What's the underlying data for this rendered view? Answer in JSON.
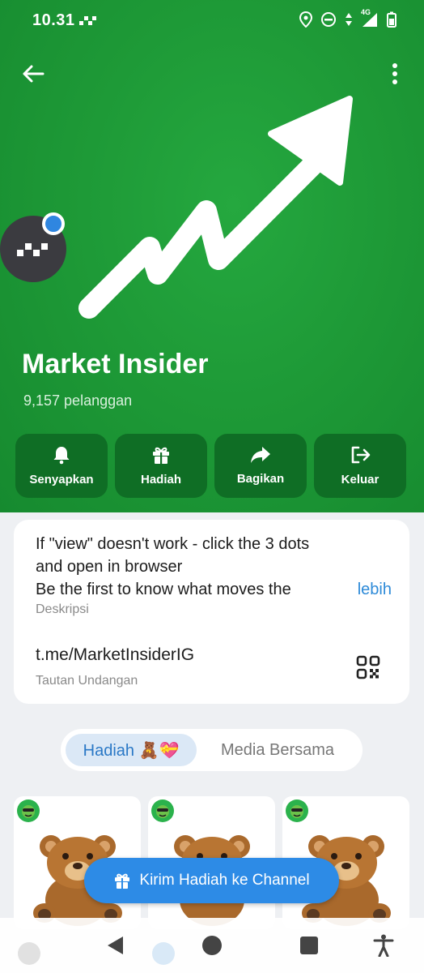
{
  "status_bar": {
    "time": "10.31",
    "network": "4G"
  },
  "header": {
    "channel_name": "Market Insider",
    "subscribers": "9,157 pelanggan",
    "background_color": "#1e9a37"
  },
  "actions": [
    {
      "label": "Senyapkan",
      "icon": "bell-icon"
    },
    {
      "label": "Hadiah",
      "icon": "gift-icon"
    },
    {
      "label": "Bagikan",
      "icon": "share-icon"
    },
    {
      "label": "Keluar",
      "icon": "logout-icon"
    }
  ],
  "info": {
    "description_line1": "If \"view\" doesn't work - click the 3 dots",
    "description_line2": "and open in browser",
    "description_line3": "Be the first to know what moves the",
    "more_label": "lebih",
    "description_caption": "Deskripsi",
    "invite_link": "t.me/MarketInsiderIG",
    "invite_caption": "Tautan Undangan"
  },
  "tabs": {
    "active": "Hadiah 🧸💝",
    "inactive": "Media Bersama"
  },
  "gifts": {
    "fab_label": "Kirim Hadiah ke Channel"
  },
  "colors": {
    "accent": "#2d8be6",
    "action_bg": "#0f6e25"
  }
}
